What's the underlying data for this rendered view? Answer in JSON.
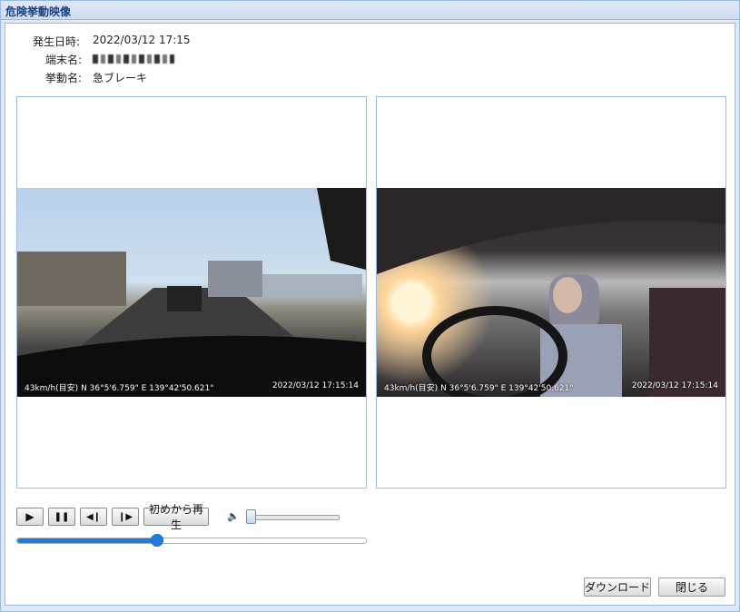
{
  "window": {
    "title": "危険挙動映像"
  },
  "info": {
    "occurred_label": "発生日時:",
    "occurred_value": "2022/03/12 17:15",
    "terminal_label": "端末名:",
    "behavior_label": "挙動名:",
    "behavior_value": "急ブレーキ"
  },
  "videos": [
    {
      "speed": "43km/h(目安)",
      "coords": "N 36°5'6.759\" E 139°42'50.621\"",
      "timestamp": "2022/03/12 17:15:14"
    },
    {
      "speed": "43km/h(目安)",
      "coords": "N 36°5'6.759\" E 139°42'50.621\"",
      "timestamp": "2022/03/12 17:15:14"
    }
  ],
  "controls": {
    "play_icon": "▶",
    "pause_icon": "❚❚",
    "step_back_icon": "◀❙",
    "step_fwd_icon": "❙▶",
    "restart_label": "初めから再生",
    "volume_icon": "🔈",
    "volume_level": 0.0,
    "seek_position": 0.4
  },
  "footer": {
    "download_label": "ダウンロード",
    "close_label": "閉じる"
  }
}
